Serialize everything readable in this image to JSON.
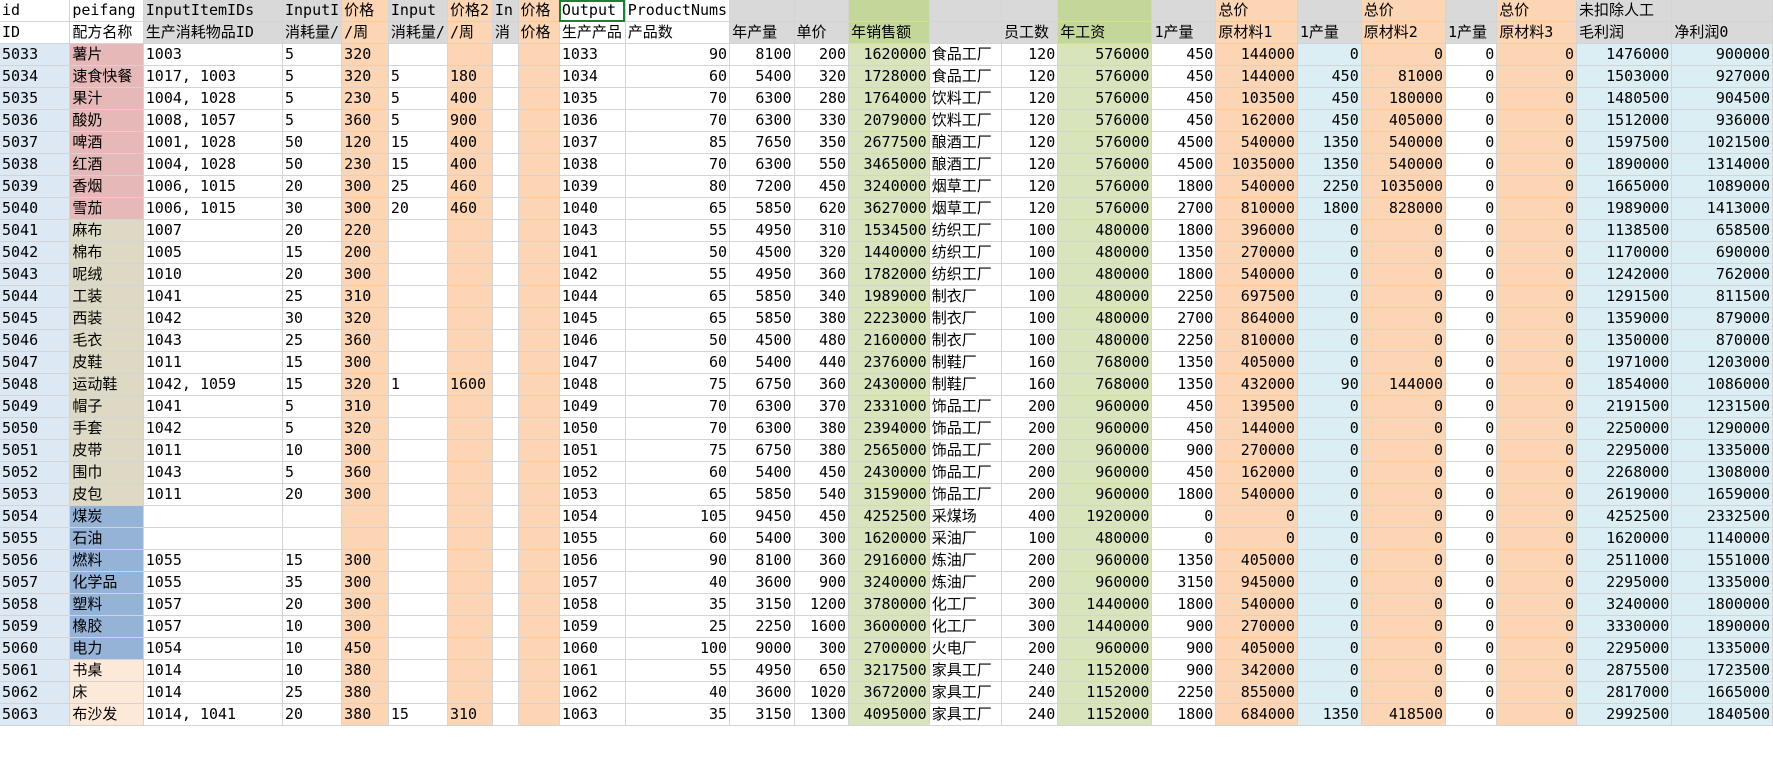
{
  "sheet": {
    "header_row1": [
      "id",
      "peifang",
      "InputItemIDs",
      "InputI",
      "价格",
      "Input",
      "价格2",
      "In",
      "价格",
      "Output",
      "ProductNums",
      "",
      "",
      "",
      "",
      "",
      "",
      "",
      "总价",
      "",
      "总价",
      "",
      "总价",
      "未扣除人工",
      ""
    ],
    "header_row2": [
      "ID",
      "配方名称",
      "生产消耗物品ID",
      "消耗量/",
      "/周",
      "消耗量/",
      "/周",
      "消",
      "价格",
      "生产产品",
      "产品数",
      "年产量",
      "单价",
      "年销售额",
      "",
      "员工数",
      "年工资",
      "1产量",
      "原材料1",
      "1产量",
      "原材料2",
      "1产量",
      "原材料3",
      "毛利润",
      "净利润0"
    ],
    "rows": [
      [
        "5033",
        "薯片",
        "1003",
        "5",
        "320",
        "",
        "",
        "",
        "",
        "1033",
        "90",
        "8100",
        "200",
        "1620000",
        "食品工厂",
        "120",
        "576000",
        "450",
        "144000",
        "0",
        "0",
        "0",
        "0",
        "1476000",
        "900000"
      ],
      [
        "5034",
        "速食快餐",
        "1017, 1003",
        "5",
        "320",
        "5",
        "180",
        "",
        "",
        "1034",
        "60",
        "5400",
        "320",
        "1728000",
        "食品工厂",
        "120",
        "576000",
        "450",
        "144000",
        "450",
        "81000",
        "0",
        "0",
        "1503000",
        "927000"
      ],
      [
        "5035",
        "果汁",
        "1004, 1028",
        "5",
        "230",
        "5",
        "400",
        "",
        "",
        "1035",
        "70",
        "6300",
        "280",
        "1764000",
        "饮料工厂",
        "120",
        "576000",
        "450",
        "103500",
        "450",
        "180000",
        "0",
        "0",
        "1480500",
        "904500"
      ],
      [
        "5036",
        "酸奶",
        "1008, 1057",
        "5",
        "360",
        "5",
        "900",
        "",
        "",
        "1036",
        "70",
        "6300",
        "330",
        "2079000",
        "饮料工厂",
        "120",
        "576000",
        "450",
        "162000",
        "450",
        "405000",
        "0",
        "0",
        "1512000",
        "936000"
      ],
      [
        "5037",
        "啤酒",
        "1001, 1028",
        "50",
        "120",
        "15",
        "400",
        "",
        "",
        "1037",
        "85",
        "7650",
        "350",
        "2677500",
        "酿酒工厂",
        "120",
        "576000",
        "4500",
        "540000",
        "1350",
        "540000",
        "0",
        "0",
        "1597500",
        "1021500"
      ],
      [
        "5038",
        "红酒",
        "1004, 1028",
        "50",
        "230",
        "15",
        "400",
        "",
        "",
        "1038",
        "70",
        "6300",
        "550",
        "3465000",
        "酿酒工厂",
        "120",
        "576000",
        "4500",
        "1035000",
        "1350",
        "540000",
        "0",
        "0",
        "1890000",
        "1314000"
      ],
      [
        "5039",
        "香烟",
        "1006, 1015",
        "20",
        "300",
        "25",
        "460",
        "",
        "",
        "1039",
        "80",
        "7200",
        "450",
        "3240000",
        "烟草工厂",
        "120",
        "576000",
        "1800",
        "540000",
        "2250",
        "1035000",
        "0",
        "0",
        "1665000",
        "1089000"
      ],
      [
        "5040",
        "雪茄",
        "1006, 1015",
        "30",
        "300",
        "20",
        "460",
        "",
        "",
        "1040",
        "65",
        "5850",
        "620",
        "3627000",
        "烟草工厂",
        "120",
        "576000",
        "2700",
        "810000",
        "1800",
        "828000",
        "0",
        "0",
        "1989000",
        "1413000"
      ],
      [
        "5041",
        "麻布",
        "1007",
        "20",
        "220",
        "",
        "",
        "",
        "",
        "1043",
        "55",
        "4950",
        "310",
        "1534500",
        "纺织工厂",
        "100",
        "480000",
        "1800",
        "396000",
        "0",
        "0",
        "0",
        "0",
        "1138500",
        "658500"
      ],
      [
        "5042",
        "棉布",
        "1005",
        "15",
        "200",
        "",
        "",
        "",
        "",
        "1041",
        "50",
        "4500",
        "320",
        "1440000",
        "纺织工厂",
        "100",
        "480000",
        "1350",
        "270000",
        "0",
        "0",
        "0",
        "0",
        "1170000",
        "690000"
      ],
      [
        "5043",
        "呢绒",
        "1010",
        "20",
        "300",
        "",
        "",
        "",
        "",
        "1042",
        "55",
        "4950",
        "360",
        "1782000",
        "纺织工厂",
        "100",
        "480000",
        "1800",
        "540000",
        "0",
        "0",
        "0",
        "0",
        "1242000",
        "762000"
      ],
      [
        "5044",
        "工装",
        "1041",
        "25",
        "310",
        "",
        "",
        "",
        "",
        "1044",
        "65",
        "5850",
        "340",
        "1989000",
        "制衣厂",
        "100",
        "480000",
        "2250",
        "697500",
        "0",
        "0",
        "0",
        "0",
        "1291500",
        "811500"
      ],
      [
        "5045",
        "西装",
        "1042",
        "30",
        "320",
        "",
        "",
        "",
        "",
        "1045",
        "65",
        "5850",
        "380",
        "2223000",
        "制衣厂",
        "100",
        "480000",
        "2700",
        "864000",
        "0",
        "0",
        "0",
        "0",
        "1359000",
        "879000"
      ],
      [
        "5046",
        "毛衣",
        "1043",
        "25",
        "360",
        "",
        "",
        "",
        "",
        "1046",
        "50",
        "4500",
        "480",
        "2160000",
        "制衣厂",
        "100",
        "480000",
        "2250",
        "810000",
        "0",
        "0",
        "0",
        "0",
        "1350000",
        "870000"
      ],
      [
        "5047",
        "皮鞋",
        "1011",
        "15",
        "300",
        "",
        "",
        "",
        "",
        "1047",
        "60",
        "5400",
        "440",
        "2376000",
        "制鞋厂",
        "160",
        "768000",
        "1350",
        "405000",
        "0",
        "0",
        "0",
        "0",
        "1971000",
        "1203000"
      ],
      [
        "5048",
        "运动鞋",
        "1042, 1059",
        "15",
        "320",
        "1",
        "1600",
        "",
        "",
        "1048",
        "75",
        "6750",
        "360",
        "2430000",
        "制鞋厂",
        "160",
        "768000",
        "1350",
        "432000",
        "90",
        "144000",
        "0",
        "0",
        "1854000",
        "1086000"
      ],
      [
        "5049",
        "帽子",
        "1041",
        "5",
        "310",
        "",
        "",
        "",
        "",
        "1049",
        "70",
        "6300",
        "370",
        "2331000",
        "饰品工厂",
        "200",
        "960000",
        "450",
        "139500",
        "0",
        "0",
        "0",
        "0",
        "2191500",
        "1231500"
      ],
      [
        "5050",
        "手套",
        "1042",
        "5",
        "320",
        "",
        "",
        "",
        "",
        "1050",
        "70",
        "6300",
        "380",
        "2394000",
        "饰品工厂",
        "200",
        "960000",
        "450",
        "144000",
        "0",
        "0",
        "0",
        "0",
        "2250000",
        "1290000"
      ],
      [
        "5051",
        "皮带",
        "1011",
        "10",
        "300",
        "",
        "",
        "",
        "",
        "1051",
        "75",
        "6750",
        "380",
        "2565000",
        "饰品工厂",
        "200",
        "960000",
        "900",
        "270000",
        "0",
        "0",
        "0",
        "0",
        "2295000",
        "1335000"
      ],
      [
        "5052",
        "围巾",
        "1043",
        "5",
        "360",
        "",
        "",
        "",
        "",
        "1052",
        "60",
        "5400",
        "450",
        "2430000",
        "饰品工厂",
        "200",
        "960000",
        "450",
        "162000",
        "0",
        "0",
        "0",
        "0",
        "2268000",
        "1308000"
      ],
      [
        "5053",
        "皮包",
        "1011",
        "20",
        "300",
        "",
        "",
        "",
        "",
        "1053",
        "65",
        "5850",
        "540",
        "3159000",
        "饰品工厂",
        "200",
        "960000",
        "1800",
        "540000",
        "0",
        "0",
        "0",
        "0",
        "2619000",
        "1659000"
      ],
      [
        "5054",
        "煤炭",
        "",
        "",
        "",
        "",
        "",
        "",
        "",
        "1054",
        "105",
        "9450",
        "450",
        "4252500",
        "采煤场",
        "400",
        "1920000",
        "0",
        "0",
        "0",
        "0",
        "0",
        "0",
        "4252500",
        "2332500"
      ],
      [
        "5055",
        "石油",
        "",
        "",
        "",
        "",
        "",
        "",
        "",
        "1055",
        "60",
        "5400",
        "300",
        "1620000",
        "采油厂",
        "100",
        "480000",
        "0",
        "0",
        "0",
        "0",
        "0",
        "0",
        "1620000",
        "1140000"
      ],
      [
        "5056",
        "燃料",
        "1055",
        "15",
        "300",
        "",
        "",
        "",
        "",
        "1056",
        "90",
        "8100",
        "360",
        "2916000",
        "炼油厂",
        "200",
        "960000",
        "1350",
        "405000",
        "0",
        "0",
        "0",
        "0",
        "2511000",
        "1551000"
      ],
      [
        "5057",
        "化学品",
        "1055",
        "35",
        "300",
        "",
        "",
        "",
        "",
        "1057",
        "40",
        "3600",
        "900",
        "3240000",
        "炼油厂",
        "200",
        "960000",
        "3150",
        "945000",
        "0",
        "0",
        "0",
        "0",
        "2295000",
        "1335000"
      ],
      [
        "5058",
        "塑料",
        "1057",
        "20",
        "300",
        "",
        "",
        "",
        "",
        "1058",
        "35",
        "3150",
        "1200",
        "3780000",
        "化工厂",
        "300",
        "1440000",
        "1800",
        "540000",
        "0",
        "0",
        "0",
        "0",
        "3240000",
        "1800000"
      ],
      [
        "5059",
        "橡胶",
        "1057",
        "10",
        "300",
        "",
        "",
        "",
        "",
        "1059",
        "25",
        "2250",
        "1600",
        "3600000",
        "化工厂",
        "300",
        "1440000",
        "900",
        "270000",
        "0",
        "0",
        "0",
        "0",
        "3330000",
        "1890000"
      ],
      [
        "5060",
        "电力",
        "1054",
        "10",
        "450",
        "",
        "",
        "",
        "",
        "1060",
        "100",
        "9000",
        "300",
        "2700000",
        "火电厂",
        "200",
        "960000",
        "900",
        "405000",
        "0",
        "0",
        "0",
        "0",
        "2295000",
        "1335000"
      ],
      [
        "5061",
        "书桌",
        "1014",
        "10",
        "380",
        "",
        "",
        "",
        "",
        "1061",
        "55",
        "4950",
        "650",
        "3217500",
        "家具工厂",
        "240",
        "1152000",
        "900",
        "342000",
        "0",
        "0",
        "0",
        "0",
        "2875500",
        "1723500"
      ],
      [
        "5062",
        "床",
        "1014",
        "25",
        "380",
        "",
        "",
        "",
        "",
        "1062",
        "40",
        "3600",
        "1020",
        "3672000",
        "家具工厂",
        "240",
        "1152000",
        "2250",
        "855000",
        "0",
        "0",
        "0",
        "0",
        "2817000",
        "1665000"
      ],
      [
        "5063",
        "布沙发",
        "1014, 1041",
        "20",
        "380",
        "15",
        "310",
        "",
        "",
        "1063",
        "35",
        "3150",
        "1300",
        "4095000",
        "家具工厂",
        "240",
        "1152000",
        "1800",
        "684000",
        "1350",
        "418500",
        "0",
        "0",
        "2992500",
        "1840500"
      ]
    ],
    "colors": {
      "id": "#dce9f4",
      "name_food": "#e6b8b7",
      "name_textile": "#ddd9c4",
      "name_energy": "#95b3d7",
      "name_furniture": "#fde9d9",
      "price": "#fcd5b4",
      "sales": "#d8e4bc",
      "total_head": "#f2b08a",
      "qty": "#daeef3",
      "grey": "#d9d9d9",
      "green_head": "#c4d79b"
    }
  }
}
